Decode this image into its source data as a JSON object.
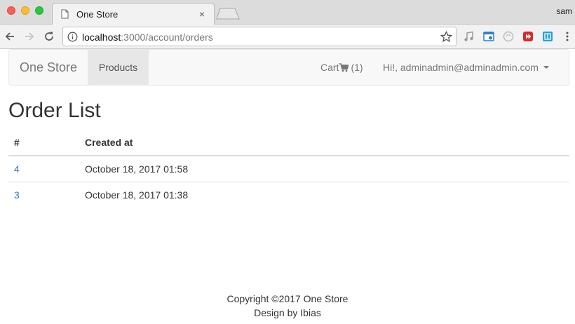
{
  "browser": {
    "tab_title": "One Store",
    "tab_close": "×",
    "profile_name": "sam",
    "url_host": "localhost",
    "url_path": ":3000/account/orders"
  },
  "navbar": {
    "brand": "One Store",
    "products": "Products",
    "cart_label": "Cart",
    "cart_count": "(1)",
    "user_greeting": "Hi!, adminadmin@adminadmin.com"
  },
  "page": {
    "title": "Order List",
    "columns": [
      "#",
      "Created at"
    ],
    "orders": [
      {
        "id": "4",
        "created_at": "October 18, 2017 01:58"
      },
      {
        "id": "3",
        "created_at": "October 18, 2017 01:38"
      }
    ]
  },
  "footer": {
    "copyright": "Copyright ©2017 One Store",
    "design": "Design by Ibias"
  },
  "colors": {
    "link": "#337ab7",
    "navbar_bg": "#f8f8f8",
    "active_nav_bg": "#e7e7e7"
  },
  "icons": [
    "page-favicon-icon",
    "close-icon",
    "back-arrow-icon",
    "forward-arrow-icon",
    "reload-icon",
    "info-icon",
    "star-icon",
    "extension-icon",
    "menu-dots-icon",
    "shopping-cart-icon",
    "caret-down-icon"
  ]
}
